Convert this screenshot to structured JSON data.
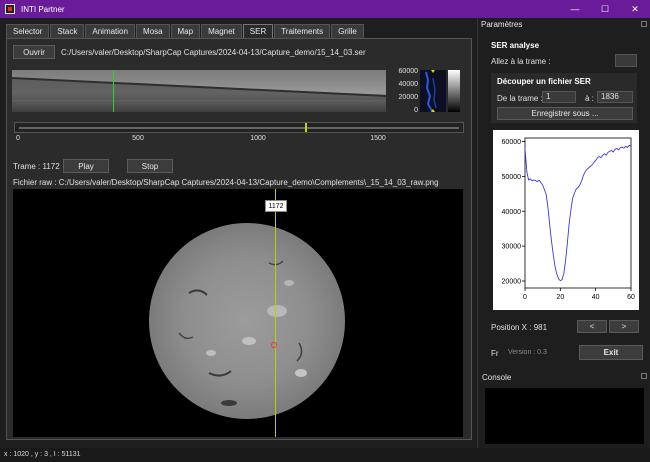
{
  "window": {
    "title": "INTI Partner",
    "controls": [
      "—",
      "☐",
      "✕"
    ]
  },
  "tabs": [
    "Selector",
    "Stack",
    "Animation",
    "Mosa",
    "Map",
    "Magnet",
    "SER",
    "Traitements",
    "Grille"
  ],
  "active_tab": "SER",
  "ser": {
    "open_label": "Ouvrir",
    "file_path": "C:/Users/valer/Desktop/SharpCap Captures/2024-04-13/Capture_demo/15_14_03.ser",
    "histogram_ticks": [
      "60000",
      "40000",
      "20000",
      "0"
    ],
    "axis_ticks": [
      "0",
      "500",
      "1000",
      "1500"
    ],
    "frame_label": "Trame  :  1172",
    "play_label": "Play",
    "stop_label": "Stop",
    "raw_file": "Fichier raw :    C:/Users/valer/Desktop/SharpCap Captures/2024-04-13/Capture_demo\\Complements\\_15_14_03_raw.png",
    "frame_tag": "1172"
  },
  "status_bar": {
    "text": "x : 1020 , y : 3 , I : 51131"
  },
  "params": {
    "title": "Paramètres",
    "section_title": "SER analyse",
    "goto_label": "Allez à la trame :",
    "goto_value": "",
    "cut_title": "Découper un fichier SER",
    "from_label": "De la trame :",
    "from_value": "1",
    "to_label": "à :",
    "to_value": "1836",
    "save_label": "Enregistrer sous ...",
    "position_label": "Position X :    981",
    "prev_label": "<",
    "next_label": ">",
    "lang_label": "Fr",
    "version_label": "Version : 0.3",
    "exit_label": "Exit"
  },
  "console": {
    "title": "Console"
  },
  "colors": {
    "titlebar": "#6a1b9a",
    "cursor_line": "#c8c800",
    "strip_marker": "#3cc83c",
    "plot_line": "#3b3bd6"
  },
  "chart_data": {
    "type": "line",
    "x": [
      0,
      1,
      2,
      3,
      4,
      5,
      6,
      7,
      8,
      9,
      10,
      11,
      12,
      13,
      14,
      15,
      16,
      17,
      18,
      19,
      20,
      21,
      22,
      23,
      24,
      25,
      26,
      27,
      28,
      29,
      30,
      31,
      32,
      33,
      34,
      35,
      36,
      37,
      38,
      39,
      40,
      41,
      42,
      43,
      44,
      45,
      46,
      47,
      48,
      49,
      50,
      51,
      52,
      53,
      54,
      55,
      56,
      57,
      58,
      59,
      60
    ],
    "series": [
      {
        "values": [
          58000,
          51500,
          49000,
          49300,
          48700,
          49000,
          48800,
          48500,
          48900,
          48200,
          47500,
          46200,
          44800,
          41000,
          36000,
          31500,
          27500,
          24200,
          22000,
          20600,
          20100,
          20400,
          22200,
          26000,
          31000,
          36500,
          40500,
          43800,
          45200,
          46400,
          46800,
          47500,
          48600,
          50200,
          51300,
          52000,
          52400,
          52900,
          53300,
          54000,
          54600,
          55300,
          55700,
          55400,
          56000,
          56500,
          56100,
          56900,
          57200,
          57400,
          57000,
          57800,
          58000,
          57600,
          58200,
          58400,
          58100,
          58600,
          58300,
          58900,
          58700
        ]
      }
    ],
    "xticks": [
      "0",
      "20",
      "40",
      "60"
    ],
    "yticks": [
      "20000",
      "30000",
      "40000",
      "50000",
      "60000"
    ],
    "xlim": [
      0,
      60
    ],
    "ylim": [
      18000,
      61000
    ],
    "xlabel": "",
    "ylabel": ""
  }
}
